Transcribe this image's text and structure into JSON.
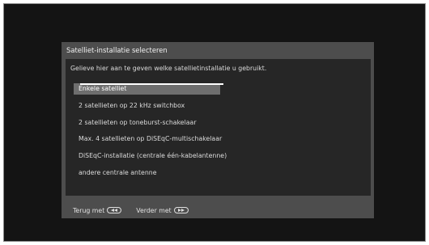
{
  "dialog": {
    "title": "Satelliet-installatie selecteren",
    "instruction": "Gelieve hier aan te geven welke satellietinstallatie u gebruikt.",
    "options": [
      {
        "label": "Enkele satelliet",
        "selected": true
      },
      {
        "label": "2 satellieten op 22 kHz switchbox",
        "selected": false
      },
      {
        "label": "2 satellieten op toneburst-schakelaar",
        "selected": false
      },
      {
        "label": "Max. 4 satellieten op DiSEqC-multischakelaar",
        "selected": false
      },
      {
        "label": "DiSEqC-installatie (centrale één-kabelantenne)",
        "selected": false
      },
      {
        "label": "andere centrale antenne",
        "selected": false
      }
    ]
  },
  "footer": {
    "back_label": "Terug met",
    "back_icon": "rewind-key-icon",
    "next_label": "Verder met",
    "next_icon": "fast-forward-key-icon"
  },
  "colors": {
    "screen_background": "#141414",
    "dialog_frame": "#4d4d4d",
    "dialog_body": "#262626",
    "selection_highlight": "#6e6e6e"
  }
}
